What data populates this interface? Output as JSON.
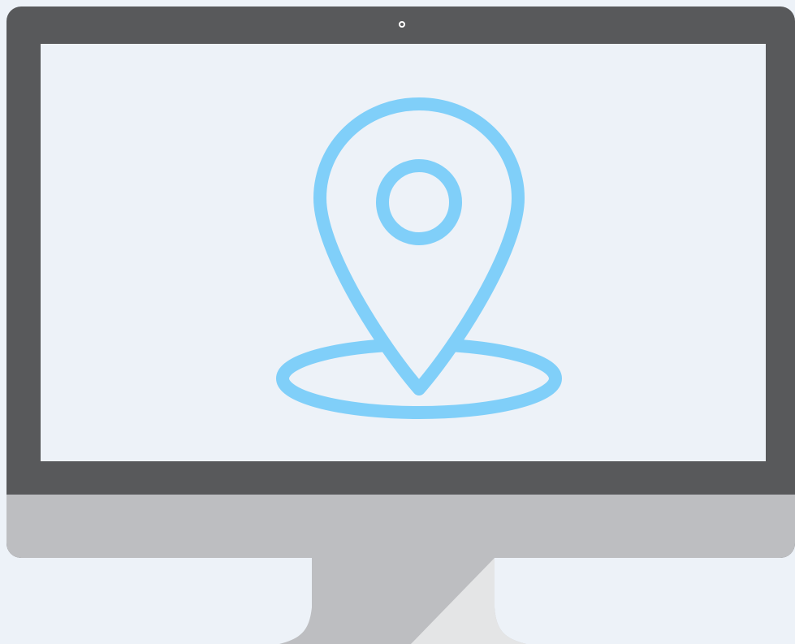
{
  "scene": {
    "subject": "desktop-monitor",
    "icon": "location-pin-icon",
    "colors": {
      "background": "#edf2f8",
      "bezel": "#58595b",
      "chin": "#bdbec1",
      "screen": "#edf2f8",
      "icon": "#80cff9",
      "stand": "#bdbec1",
      "stand_highlight": "#e4e5e6"
    }
  }
}
